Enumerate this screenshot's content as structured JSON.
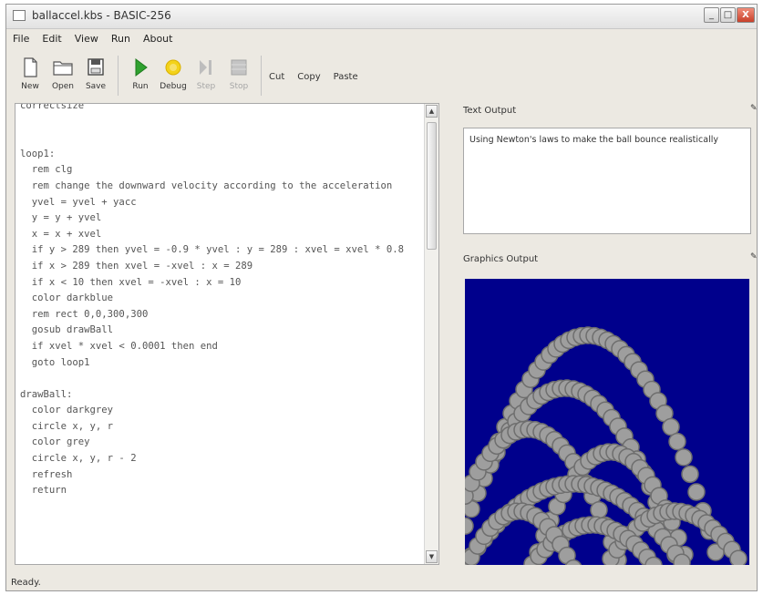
{
  "window": {
    "title": "ballaccel.kbs - BASIC-256",
    "controls": {
      "minimize": "_",
      "maximize": "□",
      "close": "X"
    }
  },
  "menu": [
    "File",
    "Edit",
    "View",
    "Run",
    "About"
  ],
  "toolbar": {
    "new_label": "New",
    "open_label": "Open",
    "save_label": "Save",
    "run_label": "Run",
    "debug_label": "Debug",
    "step_label": "Step",
    "stop_label": "Stop",
    "cut_label": "Cut",
    "copy_label": "Copy",
    "paste_label": "Paste"
  },
  "editor": {
    "lines": [
      "correctsize",
      "",
      "",
      "loop1:",
      "  rem clg",
      "  rem change the downward velocity according to the acceleration",
      "  yvel = yvel + yacc",
      "  y = y + yvel",
      "  x = x + xvel",
      "  if y > 289 then yvel = -0.9 * yvel : y = 289 : xvel = xvel * 0.8",
      "  if x > 289 then xvel = -xvel : x = 289",
      "  if x < 10 then xvel = -xvel : x = 10",
      "  color darkblue",
      "  rem rect 0,0,300,300",
      "  gosub drawBall",
      "  if xvel * xvel < 0.0001 then end",
      "  goto loop1",
      "",
      "drawBall:",
      "  color darkgrey",
      "  circle x, y, r",
      "  color grey",
      "  circle x, y, r - 2",
      "  refresh",
      "  return"
    ],
    "scroll_up": "▲",
    "scroll_down": "▼"
  },
  "text_output": {
    "title": "Text Output",
    "content": "Using Newton's laws to make the ball bounce realistically"
  },
  "graphics_output": {
    "title": "Graphics Output",
    "background": "#00008c",
    "ball_color": "#9e9e9e",
    "ball_edge": "#6e6e6e"
  },
  "status": {
    "text": "Ready."
  },
  "colors": {
    "run_green": "#2fa12f",
    "debug_yellow": "#f3d21a",
    "chrome": "#ece9e2"
  }
}
